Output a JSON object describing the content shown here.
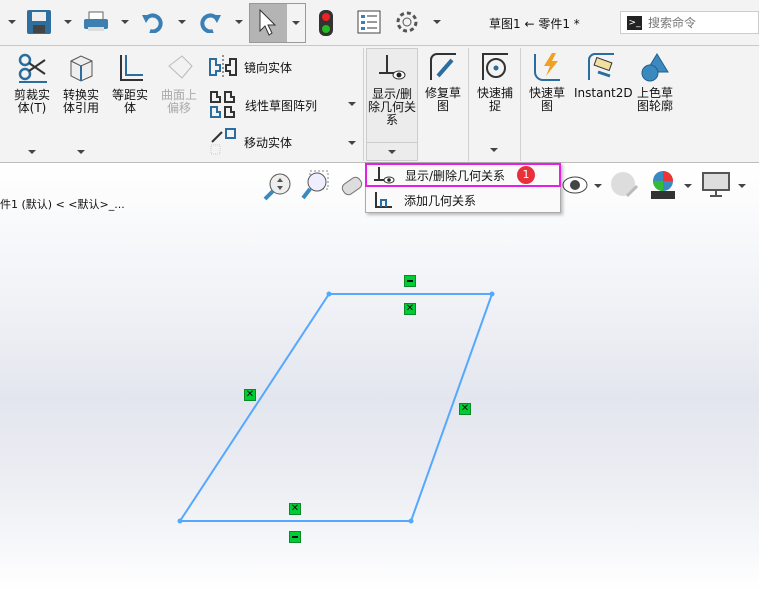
{
  "window": {
    "title": "草图1 ← 零件1 *"
  },
  "search": {
    "placeholder": "搜索命令"
  },
  "toolbar": {
    "icons": [
      "save-icon",
      "print-icon",
      "undo-icon",
      "redo-icon",
      "select-icon",
      "rebuild-icon",
      "file-properties-icon",
      "options-icon"
    ]
  },
  "ribbon": {
    "trim": "剪裁实体(T)",
    "convert": "转换实体引用",
    "offset": "等距实体",
    "offset_surface": "曲面上偏移",
    "mirror": "镜向实体",
    "linear_pattern": "线性草图阵列",
    "move": "移动实体",
    "show_relations": "显示/删除几何关系",
    "repair": "修复草图",
    "quick_snaps": "快速捕捉",
    "rapid_sketch": "快速草图",
    "instant2d": "Instant2D",
    "shaded_contours": "上色草图轮廓"
  },
  "dropdown": {
    "items": [
      "显示/删除几何关系",
      "添加几何关系"
    ],
    "badge": "1",
    "highlight_color": "#e61ee6"
  },
  "tree": {
    "label": "件1 (默认) < <默认>_..."
  },
  "sketch": {
    "line_color": "#55a8ff",
    "relation_color": "#00cc33"
  }
}
